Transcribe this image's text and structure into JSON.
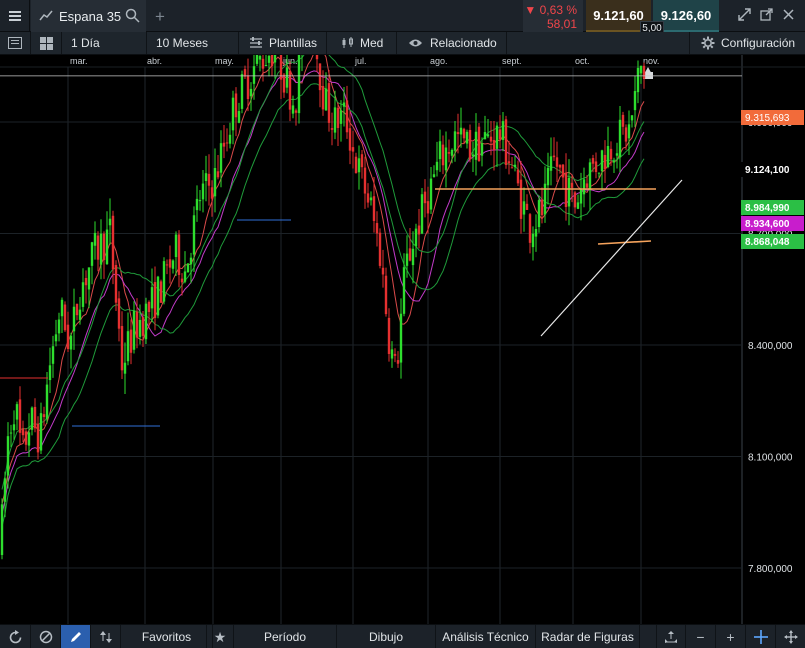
{
  "window": {
    "tab_label": "Espana 35",
    "add_tab": "+"
  },
  "quote": {
    "change_pct": "▼ 0,63 %",
    "change_abs": "58,01",
    "sell_price": "9.121,60",
    "buy_price": "9.126,60",
    "spread": "5,00"
  },
  "toolbar": {
    "interval": "1 Día",
    "range": "10 Meses",
    "templates": "Plantillas",
    "indicator": "Med",
    "related": "Relacionado",
    "settings": "Configuración"
  },
  "chart_data": {
    "type": "candlestick",
    "x_tick_labels": [
      "mar.",
      "abr.",
      "may.",
      "jun.",
      "jul.",
      "ago.",
      "sept.",
      "oct.",
      "nov."
    ],
    "y_tick_labels": [
      "7.800,000",
      "8.100,000",
      "8.400,000",
      "8.700,000",
      "9.000,000"
    ],
    "ylim": [
      7750,
      9350
    ],
    "price_labels": [
      {
        "text": "9.315,693",
        "value": 9315.693,
        "color": "#f26b3a"
      },
      {
        "text": "9.124,100",
        "value": 9124.1,
        "color": "#e8353b"
      },
      {
        "text": "8.984,990",
        "value": 8984.99,
        "color": "#2bbf45"
      },
      {
        "text": "8.934,600",
        "value": 8934.6,
        "color": "#c81dcc"
      },
      {
        "text": "8.868,048",
        "value": 8868.048,
        "color": "#2bbf45"
      }
    ],
    "current_price": 9124.1,
    "resistance_level": 9315.693,
    "colors": {
      "up": "#2ede2e",
      "down": "#e53030",
      "ma_fast": "#d94a4a",
      "ma_mid": "#c23bc9",
      "ma_slow": "#1f9a3a"
    }
  },
  "bottom": {
    "favorites": "Favoritos",
    "period": "Período",
    "drawing": "Dibujo",
    "technical": "Análisis Técnico",
    "patterns": "Radar de Figuras"
  },
  "icons": [
    "menu-icon",
    "line-chart-icon",
    "search-icon",
    "minimize-icon",
    "close-icon",
    "expand-icon",
    "popout-icon",
    "gear-icon",
    "eye-icon",
    "star-icon",
    "pencil-icon"
  ]
}
